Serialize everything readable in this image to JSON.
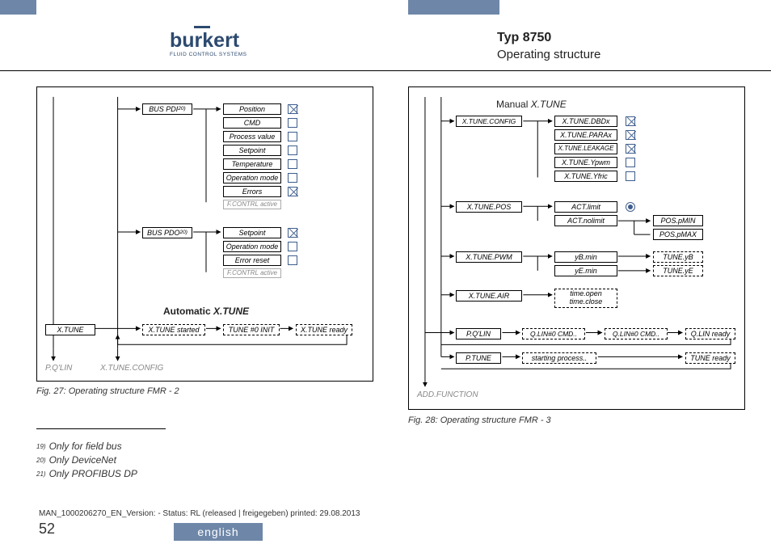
{
  "header": {
    "brand_name": "burkert",
    "brand_sub": "FLUID CONTROL SYSTEMS",
    "title": "Typ 8750",
    "sub": "Operating structure"
  },
  "left": {
    "bus_pdi": "BUS PDI",
    "pdi_sup": "20)",
    "pdi_items": [
      "Position",
      "CMD",
      "Process value",
      "Setpoint",
      "Temperature",
      "Operation mode",
      "Errors"
    ],
    "pdi_foot": "F.CONTRL active",
    "bus_pdo": "BUS PDO",
    "pdo_sup": "20)",
    "pdo_items": [
      "Setpoint",
      "Operation mode",
      "Error reset"
    ],
    "pdo_foot": "F.CONTRL active",
    "flow_title": "Automatic ",
    "flow_title_it": "X.TUNE",
    "xtune": "X.TUNE",
    "xtune_started": "X.TUNE started",
    "tune0": "TUNE #0 INIT",
    "xtune_ready": "X.TUNE ready",
    "pqlin": "P.Q'LIN",
    "xtune_config": "X.TUNE.CONFIG",
    "caption": "Fig. 27:    Operating structure FMR - 2"
  },
  "right": {
    "man_title": "Manual ",
    "man_title_it": "X.TUNE",
    "config": "X.TUNE.CONFIG",
    "dbdx": "X.TUNE.DBDx",
    "parax": "X.TUNE.PARAx",
    "leakage": "X.TUNE.LEAKAGE",
    "ypwm": "X.TUNE.Ypwm",
    "yfric": "X.TUNE.Yfric",
    "pos": "X.TUNE.POS",
    "act_limit": "ACT.limit",
    "act_nolimit": "ACT.nolimit",
    "pos_pmin": "POS.pMIN",
    "pos_pmax": "POS.pMAX",
    "pwm": "X.TUNE.PWM",
    "yb_min": "yB.min",
    "ye_min": "yE.min",
    "tune_yb": "TUNE.yB",
    "tune_ye": "TUNE.yE",
    "air": "X.TUNE.AIR",
    "time_open": "time.open",
    "time_close": "time.close",
    "pqlin": "P.Q'LIN",
    "qlin0a": "Q.LIN#0 CMD..",
    "qlin0b": "Q.LIN#0 CMD..",
    "qlin_ready": "Q.LIN ready",
    "ptune": "P.TUNE",
    "starting": "starting process..",
    "tune_ready": "TUNE ready",
    "add_func": "ADD.FUNCTION",
    "caption": "Fig. 28:    Operating structure FMR - 3"
  },
  "footnotes": [
    {
      "num": "19)",
      "text": "Only for field bus"
    },
    {
      "num": "20)",
      "text": "Only DeviceNet"
    },
    {
      "num": "21)",
      "text": "Only PROFIBUS DP"
    }
  ],
  "footer": {
    "docid": "MAN_1000206270_EN_Version: - Status: RL (released | freigegeben)  printed: 29.08.2013",
    "page": "52",
    "lang": "english"
  }
}
